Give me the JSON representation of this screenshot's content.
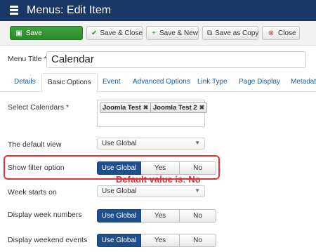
{
  "header": {
    "title": "Menus: Edit Item"
  },
  "toolbar": {
    "save": "Save",
    "save_close": "Save & Close",
    "save_new": "Save & New",
    "save_copy": "Save as Copy",
    "close": "Close"
  },
  "form": {
    "menu_title_label": "Menu Title *",
    "menu_title_value": "Calendar"
  },
  "tabs": [
    "Details",
    "Basic Options",
    "Event",
    "Advanced Options",
    "Link Type",
    "Page Display",
    "Metadata"
  ],
  "active_tab": "Basic Options",
  "fields": {
    "calendars_label": "Select Calendars *",
    "calendars": [
      "Joomla Test",
      "Joomla Test 2"
    ],
    "default_view_label": "The default view",
    "default_view_value": "Use Global",
    "filter_label": "Show filter option",
    "week_start_label": "Week starts on",
    "week_start_value": "Use Global",
    "week_numbers_label": "Display week numbers",
    "weekend_label": "Display weekend events"
  },
  "toggle": {
    "global": "Use Global",
    "yes": "Yes",
    "no": "No"
  },
  "annotation": "Default value is: No",
  "colors": {
    "header": "#1a3867",
    "save_green": "#2d8a2d",
    "active_toggle": "#1f4e8c",
    "annotation": "#e0323a"
  }
}
